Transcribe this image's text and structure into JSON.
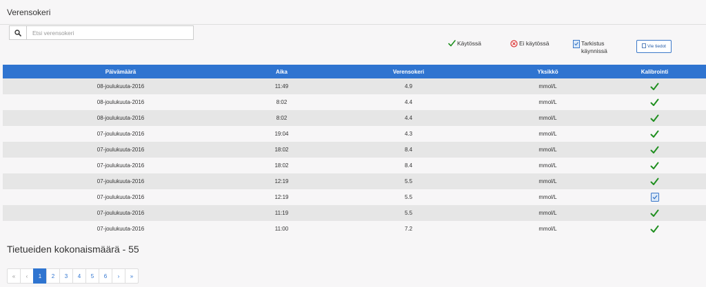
{
  "header": {
    "title": "Verensokeri"
  },
  "search": {
    "placeholder": "Etsi verensokeri"
  },
  "legend": {
    "in_use": "Käytössä",
    "not_in_use": "Ei käytössä",
    "check_line1": "Tarkistus",
    "check_line2": "käynnissä"
  },
  "export": {
    "label": "Vie tiedot"
  },
  "table": {
    "headers": [
      "Päivämäärä",
      "Aika",
      "Verensokeri",
      "Yksikkö",
      "Kalibrointi"
    ],
    "rows": [
      {
        "date": "08-joulukuuta-2016",
        "time": "11:49",
        "value": "4.9",
        "unit": "mmol/L",
        "calibration": "check"
      },
      {
        "date": "08-joulukuuta-2016",
        "time": "8:02",
        "value": "4.4",
        "unit": "mmol/L",
        "calibration": "check"
      },
      {
        "date": "08-joulukuuta-2016",
        "time": "8:02",
        "value": "4.4",
        "unit": "mmol/L",
        "calibration": "check"
      },
      {
        "date": "07-joulukuuta-2016",
        "time": "19:04",
        "value": "4.3",
        "unit": "mmol/L",
        "calibration": "check"
      },
      {
        "date": "07-joulukuuta-2016",
        "time": "18:02",
        "value": "8.4",
        "unit": "mmol/L",
        "calibration": "check"
      },
      {
        "date": "07-joulukuuta-2016",
        "time": "18:02",
        "value": "8.4",
        "unit": "mmol/L",
        "calibration": "check"
      },
      {
        "date": "07-joulukuuta-2016",
        "time": "12:19",
        "value": "5.5",
        "unit": "mmol/L",
        "calibration": "check"
      },
      {
        "date": "07-joulukuuta-2016",
        "time": "12:19",
        "value": "5.5",
        "unit": "mmol/L",
        "calibration": "pending"
      },
      {
        "date": "07-joulukuuta-2016",
        "time": "11:19",
        "value": "5.5",
        "unit": "mmol/L",
        "calibration": "check"
      },
      {
        "date": "07-joulukuuta-2016",
        "time": "11:00",
        "value": "7.2",
        "unit": "mmol/L",
        "calibration": "check"
      }
    ]
  },
  "total": {
    "label": "Tietueiden kokonaismäärä - 55"
  },
  "pagination": {
    "first": "«",
    "prev": "‹",
    "next": "›",
    "last": "»",
    "pages": [
      "1",
      "2",
      "3",
      "4",
      "5",
      "6"
    ],
    "active": "1"
  },
  "colors": {
    "accent": "#2f74d0",
    "check": "#1f8f1f",
    "error": "#d93030"
  },
  "icons": {
    "search": "search-icon",
    "check": "check-icon",
    "error": "cross-circle-icon",
    "pending": "document-check-icon",
    "export": "document-icon"
  }
}
